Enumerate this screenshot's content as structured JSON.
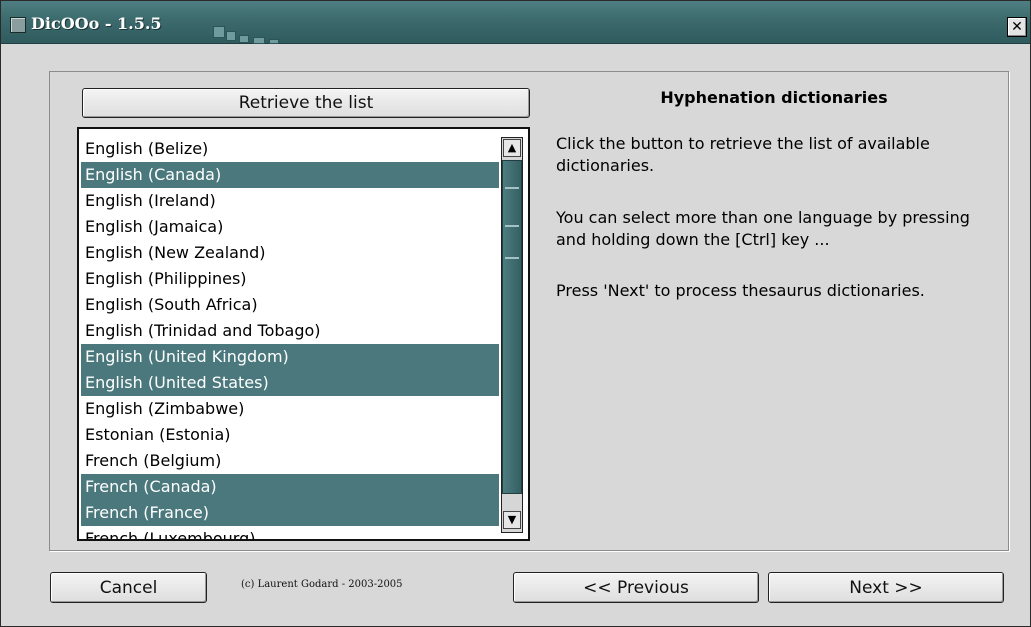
{
  "window": {
    "title": "DicOOo - 1.5.5"
  },
  "list": {
    "retrieve_label": "Retrieve the list",
    "items": [
      {
        "label": "English (Belize)",
        "selected": false
      },
      {
        "label": "English (Canada)",
        "selected": true
      },
      {
        "label": "English (Ireland)",
        "selected": false
      },
      {
        "label": "English (Jamaica)",
        "selected": false
      },
      {
        "label": "English (New Zealand)",
        "selected": false
      },
      {
        "label": "English (Philippines)",
        "selected": false
      },
      {
        "label": "English (South Africa)",
        "selected": false
      },
      {
        "label": "English (Trinidad and Tobago)",
        "selected": false
      },
      {
        "label": "English (United Kingdom)",
        "selected": true
      },
      {
        "label": "English (United States)",
        "selected": true
      },
      {
        "label": "English (Zimbabwe)",
        "selected": false
      },
      {
        "label": "Estonian (Estonia)",
        "selected": false
      },
      {
        "label": "French (Belgium)",
        "selected": false
      },
      {
        "label": "French (Canada)",
        "selected": true
      },
      {
        "label": "French (France)",
        "selected": true
      },
      {
        "label": "French (Luxembourg)",
        "selected": false
      }
    ]
  },
  "info": {
    "heading": "Hyphenation dictionaries",
    "para1": "Click the button to retrieve the list of available dictionaries.",
    "para2": "You can select more than one language by pressing and holding down  the [Ctrl] key ...",
    "para3": "Press 'Next' to process thesaurus dictionaries."
  },
  "footer": {
    "cancel_label": "Cancel",
    "copyright": "(c) Laurent Godard - 2003-2005",
    "previous_label": "<< Previous",
    "next_label": "Next >>"
  },
  "icons": {
    "close": "close-icon",
    "scroll_up": "arrow-up-icon",
    "scroll_down": "arrow-down-icon"
  },
  "colors": {
    "titlebar": "#3c6a6d",
    "selection": "#4a787c",
    "window_bg": "#d8d8d8"
  }
}
